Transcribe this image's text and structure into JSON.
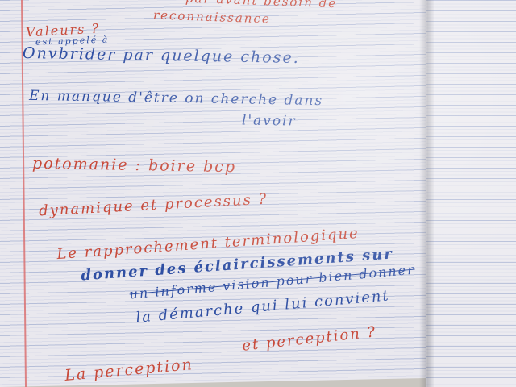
{
  "lines": [
    {
      "text": "par avant besoin de",
      "color": "red"
    },
    {
      "text": "reconnaissance",
      "color": "red"
    },
    {
      "text": "Valeurs ?",
      "color": "red"
    },
    {
      "text": "est appelé à",
      "color": "blue"
    },
    {
      "text": "Onvbrider par quelque chose.",
      "color": "blue"
    },
    {
      "text": "En manque d'être on cherche dans",
      "color": "blue"
    },
    {
      "text": "l'avoir",
      "color": "blue"
    },
    {
      "text": "potomanie : boire bcp",
      "color": "red"
    },
    {
      "text": "dynamique et processus ?",
      "color": "red"
    },
    {
      "text": "Le rapprochement terminologique",
      "color": "red"
    },
    {
      "text": "donner des éclaircissements sur",
      "color": "blue"
    },
    {
      "text": "un informe vision pour bien donner",
      "color": "blue"
    },
    {
      "text": "la démarche qui lui convient",
      "color": "blue"
    },
    {
      "text": "et perception ?",
      "color": "red"
    },
    {
      "text": "La perception",
      "color": "red"
    }
  ],
  "colors": {
    "paper": "#e9e8ee",
    "rule": "#8c9bc6",
    "margin": "#d96a6a",
    "red_ink": "#c84a3a",
    "blue_ink": "#2f4fa3"
  }
}
